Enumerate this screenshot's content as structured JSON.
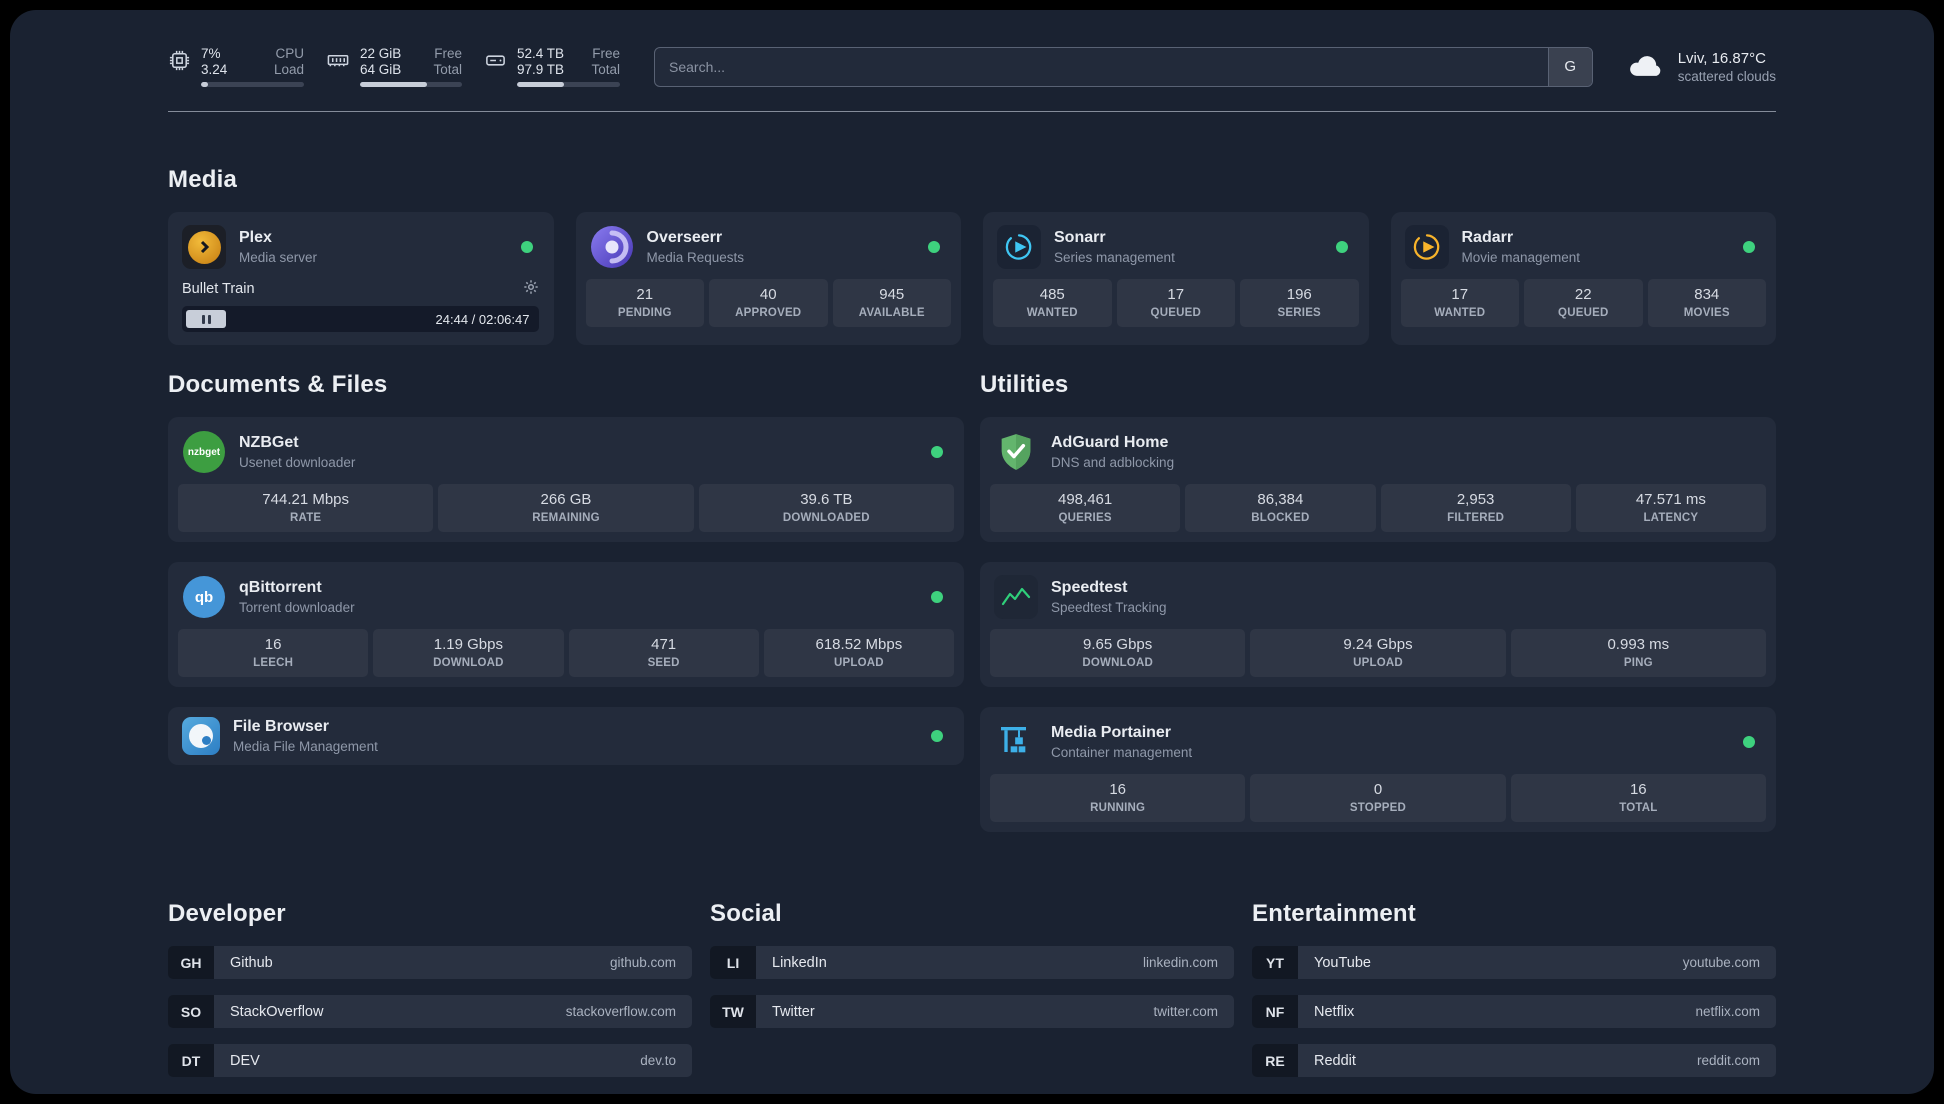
{
  "topbar": {
    "resources": [
      {
        "icon": "cpu",
        "value1": "7%",
        "label1": "CPU",
        "value2": "3.24",
        "label2": "Load",
        "progress": 7
      },
      {
        "icon": "memory",
        "value1": "22 GiB",
        "label1": "Free",
        "value2": "64 GiB",
        "label2": "Total",
        "progress": 66
      },
      {
        "icon": "disk",
        "value1": "52.4 TB",
        "label1": "Free",
        "value2": "97.9 TB",
        "label2": "Total",
        "progress": 46
      }
    ],
    "search": {
      "placeholder": "Search...",
      "value": "",
      "button_label": "G"
    },
    "weather": {
      "location": "Lviv, 16.87°C",
      "condition": "scattered clouds"
    }
  },
  "media": {
    "heading": "Media",
    "plex": {
      "name": "Plex",
      "desc": "Media server",
      "now_playing": "Bullet Train",
      "time": "24:44 / 02:06:47"
    },
    "overseerr": {
      "name": "Overseerr",
      "desc": "Media Requests",
      "stats": [
        {
          "value": "21",
          "label": "PENDING"
        },
        {
          "value": "40",
          "label": "APPROVED"
        },
        {
          "value": "945",
          "label": "AVAILABLE"
        }
      ]
    },
    "sonarr": {
      "name": "Sonarr",
      "desc": "Series management",
      "stats": [
        {
          "value": "485",
          "label": "WANTED"
        },
        {
          "value": "17",
          "label": "QUEUED"
        },
        {
          "value": "196",
          "label": "SERIES"
        }
      ]
    },
    "radarr": {
      "name": "Radarr",
      "desc": "Movie management",
      "stats": [
        {
          "value": "17",
          "label": "WANTED"
        },
        {
          "value": "22",
          "label": "QUEUED"
        },
        {
          "value": "834",
          "label": "MOVIES"
        }
      ]
    }
  },
  "docs": {
    "heading": "Documents & Files",
    "nzbget": {
      "name": "NZBGet",
      "desc": "Usenet downloader",
      "icon_text": "nzbget",
      "stats": [
        {
          "value": "744.21 Mbps",
          "label": "RATE"
        },
        {
          "value": "266 GB",
          "label": "REMAINING"
        },
        {
          "value": "39.6 TB",
          "label": "DOWNLOADED"
        }
      ]
    },
    "qbittorrent": {
      "name": "qBittorrent",
      "desc": "Torrent downloader",
      "icon_text": "qb",
      "stats": [
        {
          "value": "16",
          "label": "LEECH"
        },
        {
          "value": "1.19 Gbps",
          "label": "DOWNLOAD"
        },
        {
          "value": "471",
          "label": "SEED"
        },
        {
          "value": "618.52 Mbps",
          "label": "UPLOAD"
        }
      ]
    },
    "filebrowser": {
      "name": "File Browser",
      "desc": "Media File Management"
    }
  },
  "utilities": {
    "heading": "Utilities",
    "adguard": {
      "name": "AdGuard Home",
      "desc": "DNS and adblocking",
      "stats": [
        {
          "value": "498,461",
          "label": "QUERIES"
        },
        {
          "value": "86,384",
          "label": "BLOCKED"
        },
        {
          "value": "2,953",
          "label": "FILTERED"
        },
        {
          "value": "47.571 ms",
          "label": "LATENCY"
        }
      ]
    },
    "speedtest": {
      "name": "Speedtest",
      "desc": "Speedtest Tracking",
      "stats": [
        {
          "value": "9.65 Gbps",
          "label": "DOWNLOAD"
        },
        {
          "value": "9.24 Gbps",
          "label": "UPLOAD"
        },
        {
          "value": "0.993 ms",
          "label": "PING"
        }
      ]
    },
    "portainer": {
      "name": "Media Portainer",
      "desc": "Container management",
      "stats": [
        {
          "value": "16",
          "label": "RUNNING"
        },
        {
          "value": "0",
          "label": "STOPPED"
        },
        {
          "value": "16",
          "label": "TOTAL"
        }
      ]
    }
  },
  "bookmarks": {
    "developer": {
      "heading": "Developer",
      "items": [
        {
          "abbr": "GH",
          "name": "Github",
          "domain": "github.com"
        },
        {
          "abbr": "SO",
          "name": "StackOverflow",
          "domain": "stackoverflow.com"
        },
        {
          "abbr": "DT",
          "name": "DEV",
          "domain": "dev.to"
        }
      ]
    },
    "social": {
      "heading": "Social",
      "items": [
        {
          "abbr": "LI",
          "name": "LinkedIn",
          "domain": "linkedin.com"
        },
        {
          "abbr": "TW",
          "name": "Twitter",
          "domain": "twitter.com"
        }
      ]
    },
    "entertainment": {
      "heading": "Entertainment",
      "items": [
        {
          "abbr": "YT",
          "name": "YouTube",
          "domain": "youtube.com"
        },
        {
          "abbr": "NF",
          "name": "Netflix",
          "domain": "netflix.com"
        },
        {
          "abbr": "RE",
          "name": "Reddit",
          "domain": "reddit.com"
        }
      ]
    }
  },
  "colors": {
    "status_online": "#3ed17e",
    "plex_accent": "#e8a22c",
    "overseerr_accent": "#6a5ae0",
    "sonarr_accent": "#3fc6f3",
    "radarr_accent": "#f7b32b",
    "nzbget_accent": "#3d9e41",
    "qbittorrent_accent": "#4596d8",
    "filebrowser_accent": "#3f8fcc",
    "adguard_accent": "#5fb368",
    "speedtest_accent": "#2fcf7a",
    "portainer_accent": "#3db0e8"
  }
}
